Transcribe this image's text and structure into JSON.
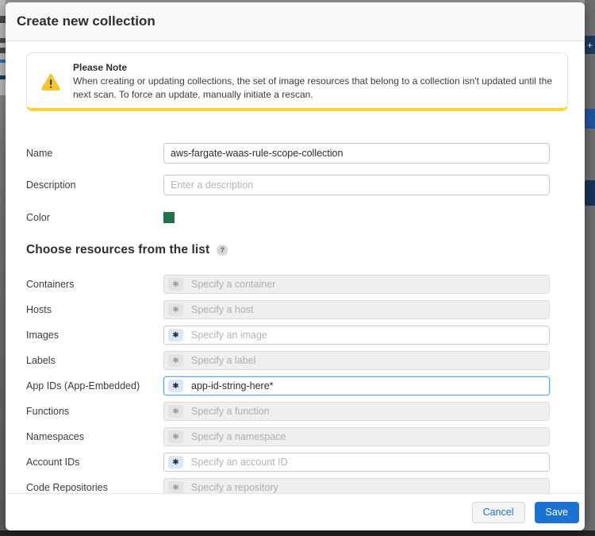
{
  "modal": {
    "title": "Create new collection",
    "note": {
      "title": "Please Note",
      "line1": "When creating or updating collections, the set of image resources that belong to a collection isn't updated until the",
      "line2": "next scan. To force an update, manually initiate a rescan."
    },
    "fields": {
      "name": {
        "label": "Name",
        "value": "aws-fargate-waas-rule-scope-collection"
      },
      "description": {
        "label": "Description",
        "placeholder": "Enter a description"
      },
      "color": {
        "label": "Color",
        "value": "#1e734a"
      }
    },
    "resources_heading": "Choose resources from the list",
    "resources": [
      {
        "label": "Containers",
        "placeholder": "Specify a container",
        "state": "disabled"
      },
      {
        "label": "Hosts",
        "placeholder": "Specify a host",
        "state": "disabled"
      },
      {
        "label": "Images",
        "placeholder": "Specify an image",
        "state": "enabled"
      },
      {
        "label": "Labels",
        "placeholder": "Specify a label",
        "state": "disabled"
      },
      {
        "label": "App IDs (App-Embedded)",
        "value": "app-id-string-here*",
        "state": "focused"
      },
      {
        "label": "Functions",
        "placeholder": "Specify a function",
        "state": "disabled"
      },
      {
        "label": "Namespaces",
        "placeholder": "Specify a namespace",
        "state": "disabled"
      },
      {
        "label": "Account IDs",
        "placeholder": "Specify an account ID",
        "state": "enabled"
      },
      {
        "label": "Code Repositories",
        "placeholder": "Specify a repository",
        "state": "disabled"
      }
    ],
    "footer": {
      "cancel_label": "Cancel",
      "save_label": "Save"
    }
  },
  "backdrop": {
    "plus_label": "+"
  },
  "ui": {
    "asterisk": "✱",
    "help_glyph": "?"
  },
  "colors": {
    "accent_blue": "#1b72d2",
    "warning_yellow": "#fdd335",
    "swatch_green": "#1e734a",
    "focus_border": "#6fa7e0",
    "backdrop_navy": "#1d3a5e"
  }
}
